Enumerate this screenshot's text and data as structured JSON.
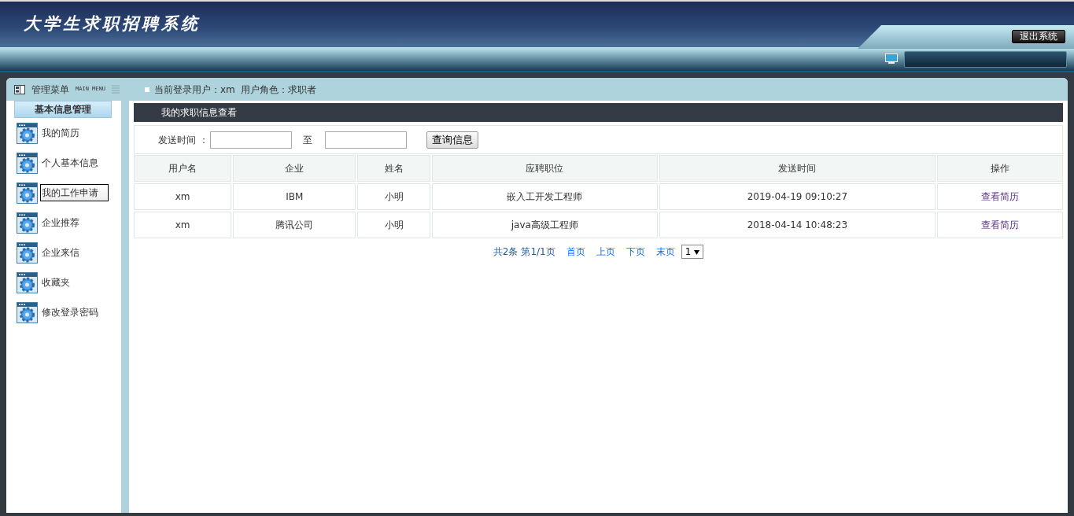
{
  "header": {
    "title": "大学生求职招聘系统",
    "logout_button": "退出系统"
  },
  "menu": {
    "title": "管理菜单",
    "subtitle": "MAIN MENU"
  },
  "user_info": "当前登录用户：xm  用户角色：求职者",
  "sidebar": {
    "section": "基本信息管理",
    "items": [
      {
        "label": "我的简历",
        "selected": false
      },
      {
        "label": "个人基本信息",
        "selected": false
      },
      {
        "label": "我的工作申请",
        "selected": true
      },
      {
        "label": "企业推荐",
        "selected": false
      },
      {
        "label": "企业来信",
        "selected": false
      },
      {
        "label": "收藏夹",
        "selected": false
      },
      {
        "label": "修改登录密码",
        "selected": false
      }
    ]
  },
  "content": {
    "title": "我的求职信息查看",
    "filter": {
      "label": "发送时间 ：",
      "separator": "至",
      "button": "查询信息"
    },
    "table": {
      "columns": [
        "用户名",
        "企业",
        "姓名",
        "应聘职位",
        "发送时间",
        "操作"
      ],
      "rows": [
        [
          "xm",
          "IBM",
          "小明",
          "嵌入工开发工程师",
          "2019-04-19 09:10:27",
          "查看简历"
        ],
        [
          "xm",
          "腾讯公司",
          "小明",
          "java高级工程师",
          "2018-04-14 10:48:23",
          "查看简历"
        ]
      ]
    },
    "pagination": {
      "summary": "共2条",
      "page": "第1/1页",
      "links": [
        "首页",
        "上页",
        "下页",
        "末页"
      ],
      "page_select": "1"
    }
  }
}
